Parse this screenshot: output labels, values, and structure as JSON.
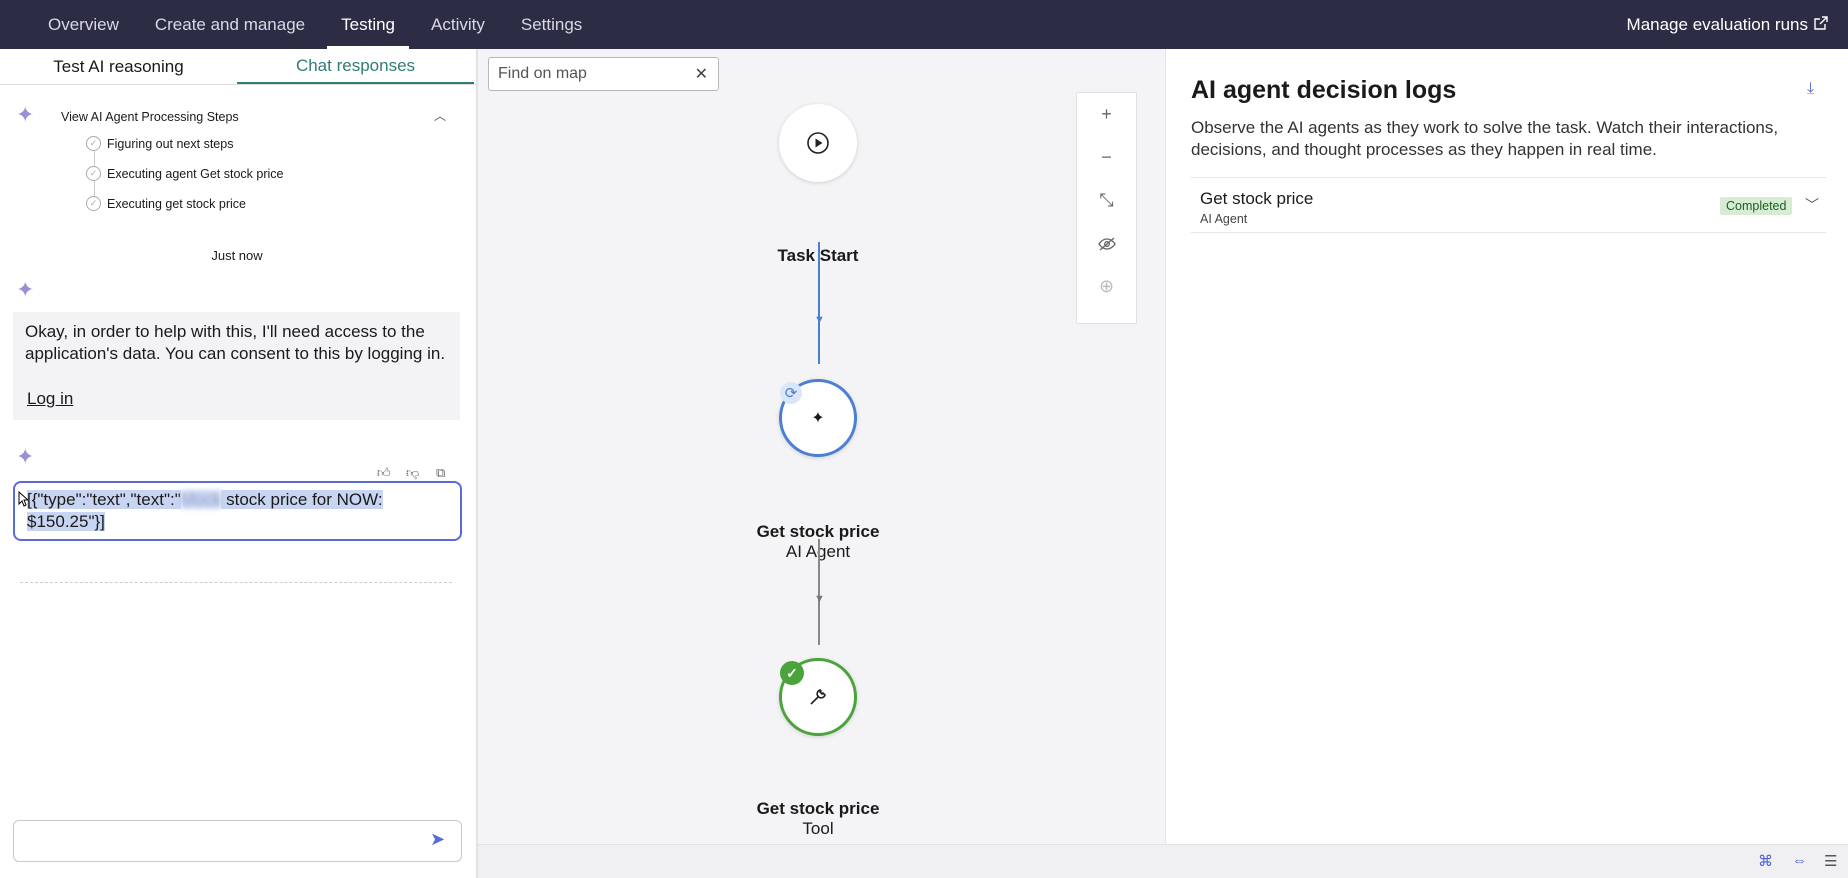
{
  "nav": {
    "tabs": [
      "Overview",
      "Create and manage",
      "Testing",
      "Activity",
      "Settings"
    ],
    "active": "Testing",
    "manage_label": "Manage evaluation runs"
  },
  "left": {
    "subtabs": [
      "Test AI reasoning",
      "Chat responses"
    ],
    "steps_title": "View AI Agent Processing Steps",
    "steps": [
      "Figuring out next steps",
      "Executing agent Get stock price",
      "Executing get stock price"
    ],
    "timestamp": "Just now",
    "message_text": "Okay, in order to help with this, I'll need access to the application's data. You can consent to this by logging in.",
    "login_label": "Log in",
    "response_prefix": "[{\"type\":\"text\",\"text\":\"",
    "response_blurred": "Mock",
    "response_suffix": " stock price for NOW: $150.25\"}]",
    "input_placeholder": ""
  },
  "map": {
    "find_placeholder": "Find on map",
    "nodes": [
      {
        "title": "Task Start",
        "subtitle": ""
      },
      {
        "title": "Get stock price",
        "subtitle": "AI Agent"
      },
      {
        "title": "Get stock price",
        "subtitle": "Tool"
      }
    ]
  },
  "logs": {
    "title": "AI agent decision logs",
    "description": "Observe the AI agents as they work to solve the task. Watch their interactions, decisions, and thought processes as they happen in real time.",
    "entry_title": "Get stock price",
    "entry_subtitle": "AI Agent",
    "entry_status": "Completed"
  },
  "colors": {
    "nav_bg": "#2c2d45",
    "accent": "#5a6bd6",
    "teal": "#2f7d74",
    "success": "#4ba33c"
  }
}
